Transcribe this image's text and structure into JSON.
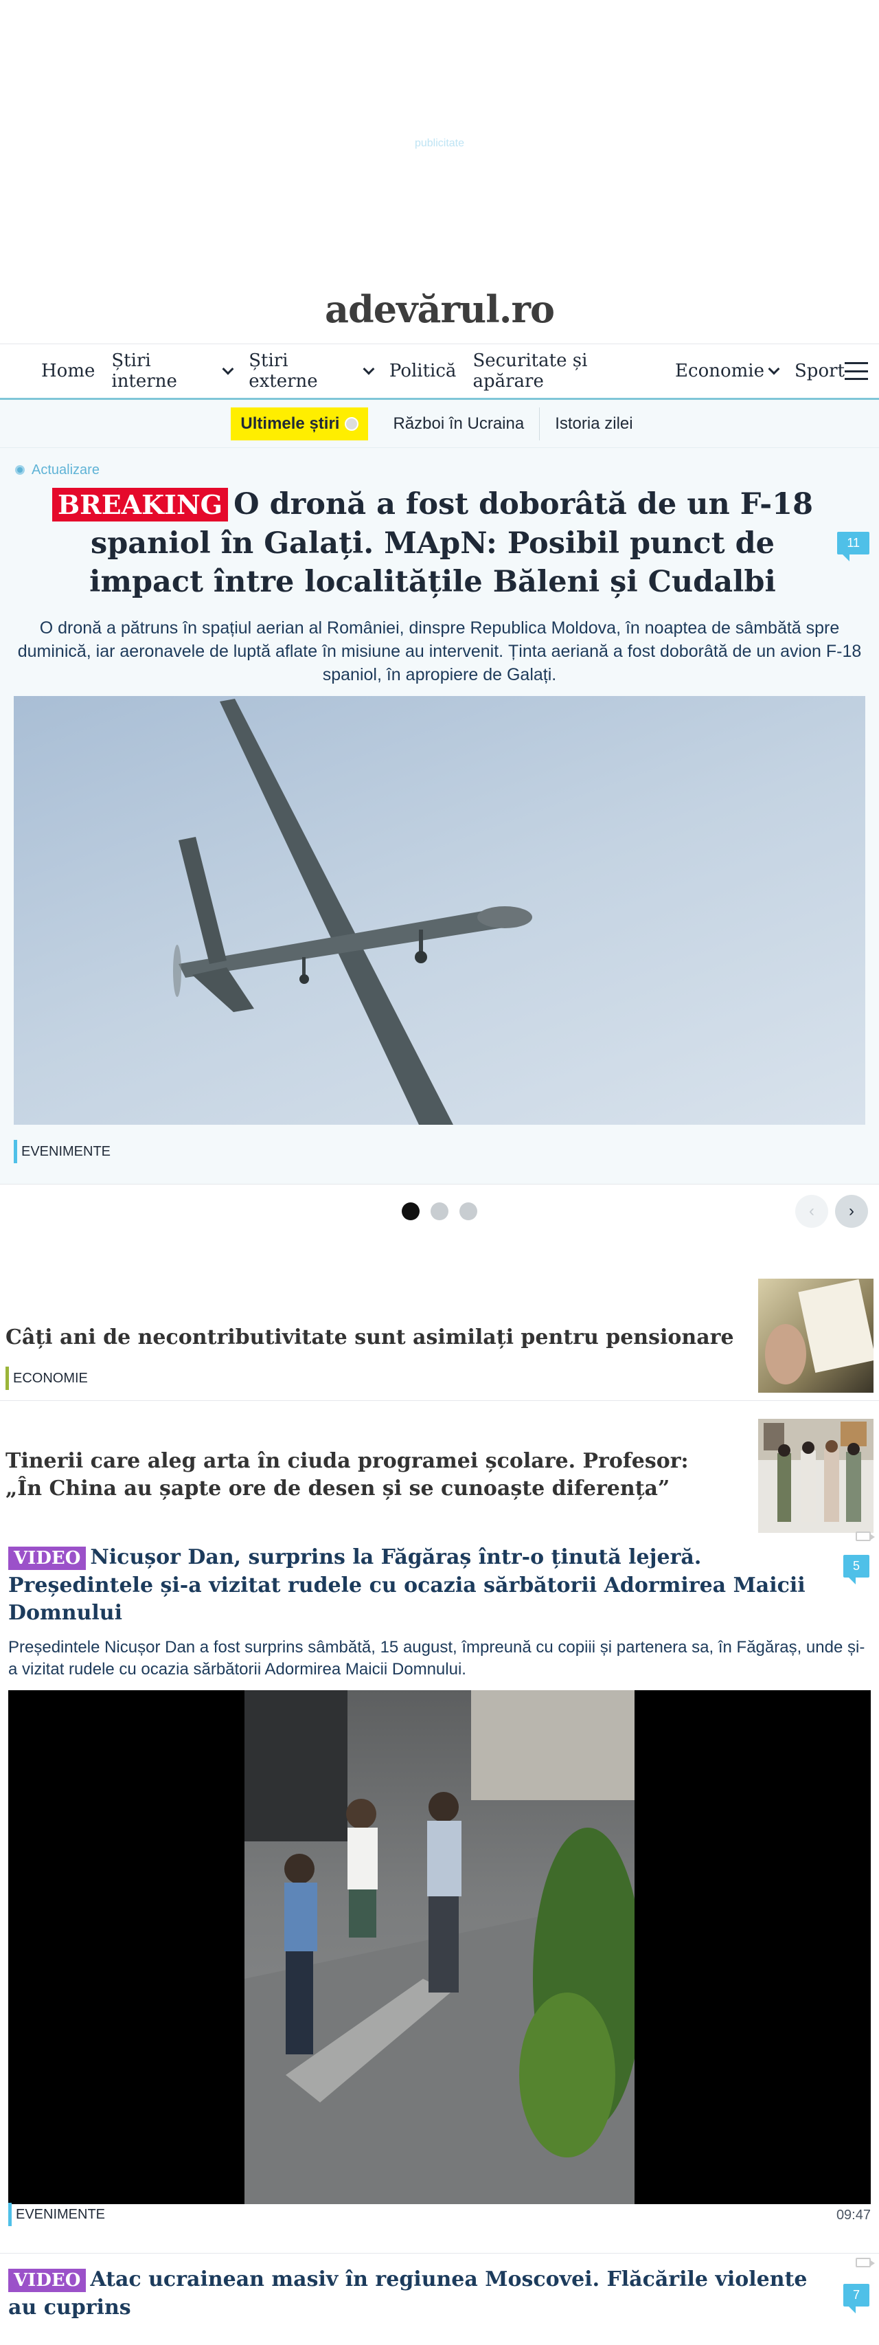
{
  "ad": {
    "label": "publicitate"
  },
  "site": {
    "logo": "adevărul.ro"
  },
  "nav": {
    "items": [
      {
        "label": "Home",
        "dropdown": false
      },
      {
        "label": "Știri interne",
        "dropdown": true
      },
      {
        "label": "Știri externe",
        "dropdown": true
      },
      {
        "label": "Politică",
        "dropdown": false
      },
      {
        "label": "Securitate și apărare",
        "dropdown": false
      },
      {
        "label": "Economie",
        "dropdown": true
      },
      {
        "label": "Sport",
        "dropdown": false
      }
    ]
  },
  "subnav": {
    "highlight": "Ultimele știri",
    "links": [
      "Război în Ucraina",
      "Istoria zilei"
    ]
  },
  "hero": {
    "update_label": "Actualizare",
    "badge": "BREAKING",
    "title": "O dronă a fost doborâtă de un F-18 spaniol în Galați. MApN: Posibil punct de impact între localitățile Băleni și Cudalbi",
    "comments": "11",
    "lead": "O dronă a pătruns în spațiul aerian al României, dinspre Republica Moldova, în noaptea de sâmbătă spre duminică, iar aeronavele de luptă aflate în misiune au intervenit. Ținta aeriană a fost doborâtă de un avion F-18 spaniol, în apropiere de Galați.",
    "category": "EVENIMENTE",
    "category_color": "#4fc0e8"
  },
  "carousel": {
    "dots": 3,
    "active": 0
  },
  "list": [
    {
      "title": "Câți ani de necontributivitate sunt asimilați pentru pensionare",
      "category": "ECONOMIE",
      "category_color": "#9bb53a"
    },
    {
      "title": "Tinerii care aleg arta în ciuda programei școlare. Profesor: „În China au șapte ore de desen și se cunoaște diferența”"
    }
  ],
  "video1": {
    "badge": "VIDEO",
    "title": "Nicușor Dan, surprins la Făgăraș într-o ținută lejeră. Președintele și-a vizitat rudele cu ocazia sărbătorii Adormirea Maicii Domnului",
    "comments": "5",
    "lead": "Președintele Nicușor Dan a fost surprins sâmbătă, 15 august, împreună cu copiii și partenera sa, în Făgăraș, unde și-a vizitat rudele cu ocazia sărbătorii Adormirea Maicii Domnului.",
    "category": "EVENIMENTE",
    "time": "09:47"
  },
  "video2": {
    "badge": "VIDEO",
    "title": "Atac ucrainean masiv în regiunea Moscovei. Flăcările violente au cuprins",
    "comments": "7"
  }
}
